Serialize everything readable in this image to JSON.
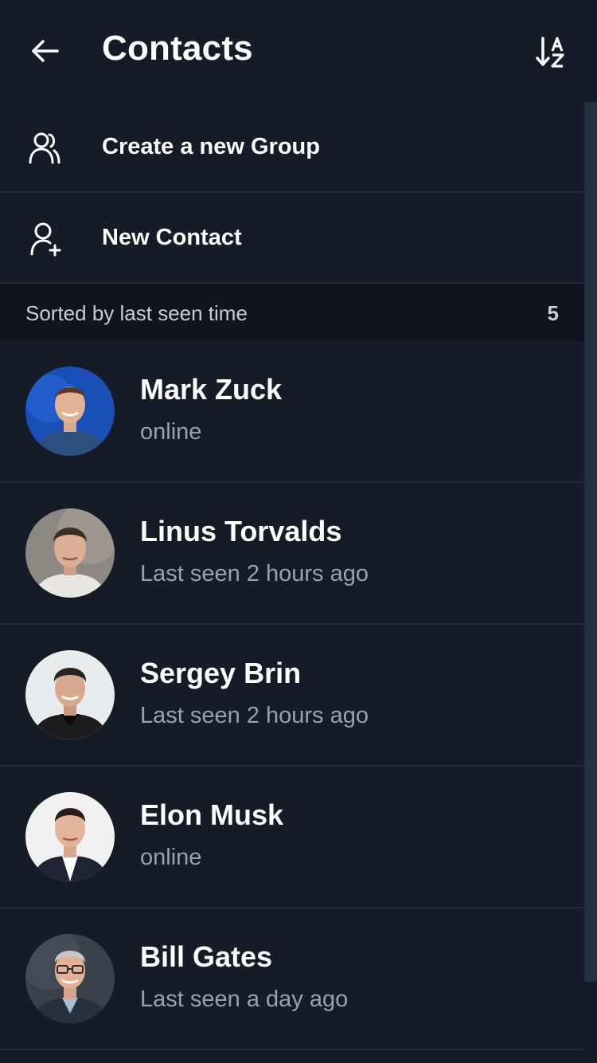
{
  "header": {
    "title": "Contacts",
    "back_icon": "arrow-left-icon",
    "sort_icon": "sort-alpha-icon"
  },
  "actions": [
    {
      "label": "Create a new Group",
      "icon": "group-icon"
    },
    {
      "label": "New Contact",
      "icon": "add-person-icon"
    }
  ],
  "section": {
    "title": "Sorted by last seen time",
    "count": "5"
  },
  "contacts": [
    {
      "name": "Mark Zuck",
      "status": "online"
    },
    {
      "name": "Linus Torvalds",
      "status": "Last seen 2 hours ago"
    },
    {
      "name": "Sergey Brin",
      "status": "Last seen 2 hours ago"
    },
    {
      "name": "Elon Musk",
      "status": "online"
    },
    {
      "name": "Bill Gates",
      "status": "Last seen a day ago"
    }
  ],
  "colors": {
    "background": "#161c27",
    "section_background": "#10151d",
    "divider": "#222a36",
    "text_primary": "#ffffff",
    "text_secondary": "#9aa1ab"
  }
}
